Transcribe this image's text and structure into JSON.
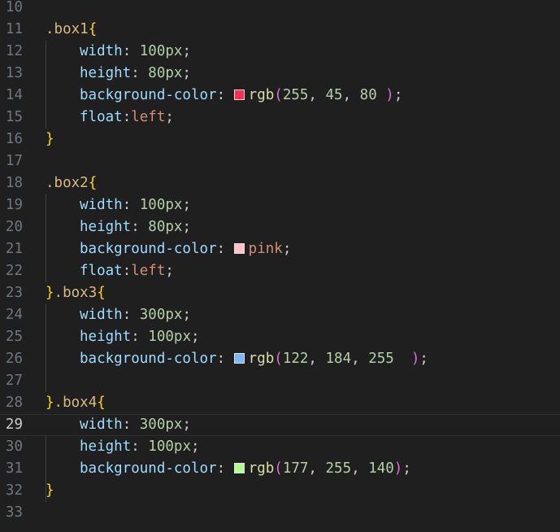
{
  "lines": [
    {
      "no": "10",
      "tokens": []
    },
    {
      "no": "11",
      "tokens": [
        [
          "sel",
          ".box1"
        ],
        [
          "brace",
          "{"
        ]
      ]
    },
    {
      "no": "12",
      "indent": true,
      "tokens": [
        [
          "prop",
          "width"
        ],
        [
          "punc",
          ": "
        ],
        [
          "num",
          "100px"
        ],
        [
          "punc",
          ";"
        ]
      ]
    },
    {
      "no": "13",
      "indent": true,
      "tokens": [
        [
          "prop",
          "height"
        ],
        [
          "punc",
          ": "
        ],
        [
          "num",
          "80px"
        ],
        [
          "punc",
          ";"
        ]
      ]
    },
    {
      "no": "14",
      "indent": true,
      "tokens": [
        [
          "prop",
          "background-color"
        ],
        [
          "punc",
          ": "
        ],
        [
          "swatch",
          "#ff2d50"
        ],
        [
          "fn",
          "rgb"
        ],
        [
          "paren",
          "("
        ],
        [
          "num",
          "255"
        ],
        [
          "punc",
          ", "
        ],
        [
          "num",
          "45"
        ],
        [
          "punc",
          ", "
        ],
        [
          "num",
          "80"
        ],
        [
          "punc",
          " "
        ],
        [
          "paren",
          ")"
        ],
        [
          "punc",
          ";"
        ]
      ]
    },
    {
      "no": "15",
      "indent": true,
      "tokens": [
        [
          "prop",
          "float"
        ],
        [
          "punc",
          ":"
        ],
        [
          "val",
          "left"
        ],
        [
          "punc",
          ";"
        ]
      ]
    },
    {
      "no": "16",
      "tokens": [
        [
          "brace",
          "}"
        ]
      ]
    },
    {
      "no": "17",
      "tokens": []
    },
    {
      "no": "18",
      "tokens": [
        [
          "sel",
          ".box2"
        ],
        [
          "brace",
          "{"
        ]
      ]
    },
    {
      "no": "19",
      "indent": true,
      "tokens": [
        [
          "prop",
          "width"
        ],
        [
          "punc",
          ": "
        ],
        [
          "num",
          "100px"
        ],
        [
          "punc",
          ";"
        ]
      ]
    },
    {
      "no": "20",
      "indent": true,
      "tokens": [
        [
          "prop",
          "height"
        ],
        [
          "punc",
          ": "
        ],
        [
          "num",
          "80px"
        ],
        [
          "punc",
          ";"
        ]
      ]
    },
    {
      "no": "21",
      "indent": true,
      "tokens": [
        [
          "prop",
          "background-color"
        ],
        [
          "punc",
          ": "
        ],
        [
          "swatch",
          "#ffc0cb"
        ],
        [
          "val",
          "pink"
        ],
        [
          "punc",
          ";"
        ]
      ]
    },
    {
      "no": "22",
      "indent": true,
      "tokens": [
        [
          "prop",
          "float"
        ],
        [
          "punc",
          ":"
        ],
        [
          "val",
          "left"
        ],
        [
          "punc",
          ";"
        ]
      ]
    },
    {
      "no": "23",
      "tokens": [
        [
          "brace",
          "}"
        ],
        [
          "sel",
          ".box3"
        ],
        [
          "brace",
          "{"
        ]
      ]
    },
    {
      "no": "24",
      "indent": true,
      "tokens": [
        [
          "prop",
          "width"
        ],
        [
          "punc",
          ": "
        ],
        [
          "num",
          "300px"
        ],
        [
          "punc",
          ";"
        ]
      ]
    },
    {
      "no": "25",
      "indent": true,
      "tokens": [
        [
          "prop",
          "height"
        ],
        [
          "punc",
          ": "
        ],
        [
          "num",
          "100px"
        ],
        [
          "punc",
          ";"
        ]
      ]
    },
    {
      "no": "26",
      "indent": true,
      "tokens": [
        [
          "prop",
          "background-color"
        ],
        [
          "punc",
          ": "
        ],
        [
          "swatch",
          "#7ab8ff"
        ],
        [
          "fn",
          "rgb"
        ],
        [
          "paren",
          "("
        ],
        [
          "num",
          "122"
        ],
        [
          "punc",
          ", "
        ],
        [
          "num",
          "184"
        ],
        [
          "punc",
          ", "
        ],
        [
          "num",
          "255"
        ],
        [
          "punc",
          "  "
        ],
        [
          "paren",
          ")"
        ],
        [
          "punc",
          ";"
        ]
      ]
    },
    {
      "no": "27",
      "tokens": []
    },
    {
      "no": "28",
      "tokens": [
        [
          "brace",
          "}"
        ],
        [
          "sel",
          ".box4"
        ],
        [
          "brace",
          "{"
        ]
      ]
    },
    {
      "no": "29",
      "indent": true,
      "current": true,
      "tokens": [
        [
          "prop",
          "width"
        ],
        [
          "punc",
          ": "
        ],
        [
          "num",
          "300px"
        ],
        [
          "punc",
          ";"
        ]
      ]
    },
    {
      "no": "30",
      "indent": true,
      "tokens": [
        [
          "prop",
          "height"
        ],
        [
          "punc",
          ": "
        ],
        [
          "num",
          "100px"
        ],
        [
          "punc",
          ";"
        ]
      ]
    },
    {
      "no": "31",
      "indent": true,
      "tokens": [
        [
          "prop",
          "background-color"
        ],
        [
          "punc",
          ": "
        ],
        [
          "swatch",
          "#b1ff8c"
        ],
        [
          "fn",
          "rgb"
        ],
        [
          "paren",
          "("
        ],
        [
          "num",
          "177"
        ],
        [
          "punc",
          ", "
        ],
        [
          "num",
          "255"
        ],
        [
          "punc",
          ", "
        ],
        [
          "num",
          "140"
        ],
        [
          "paren",
          ")"
        ],
        [
          "punc",
          ";"
        ]
      ]
    },
    {
      "no": "32",
      "tokens": [
        [
          "brace",
          "}"
        ]
      ]
    },
    {
      "no": "33",
      "tokens": []
    }
  ]
}
